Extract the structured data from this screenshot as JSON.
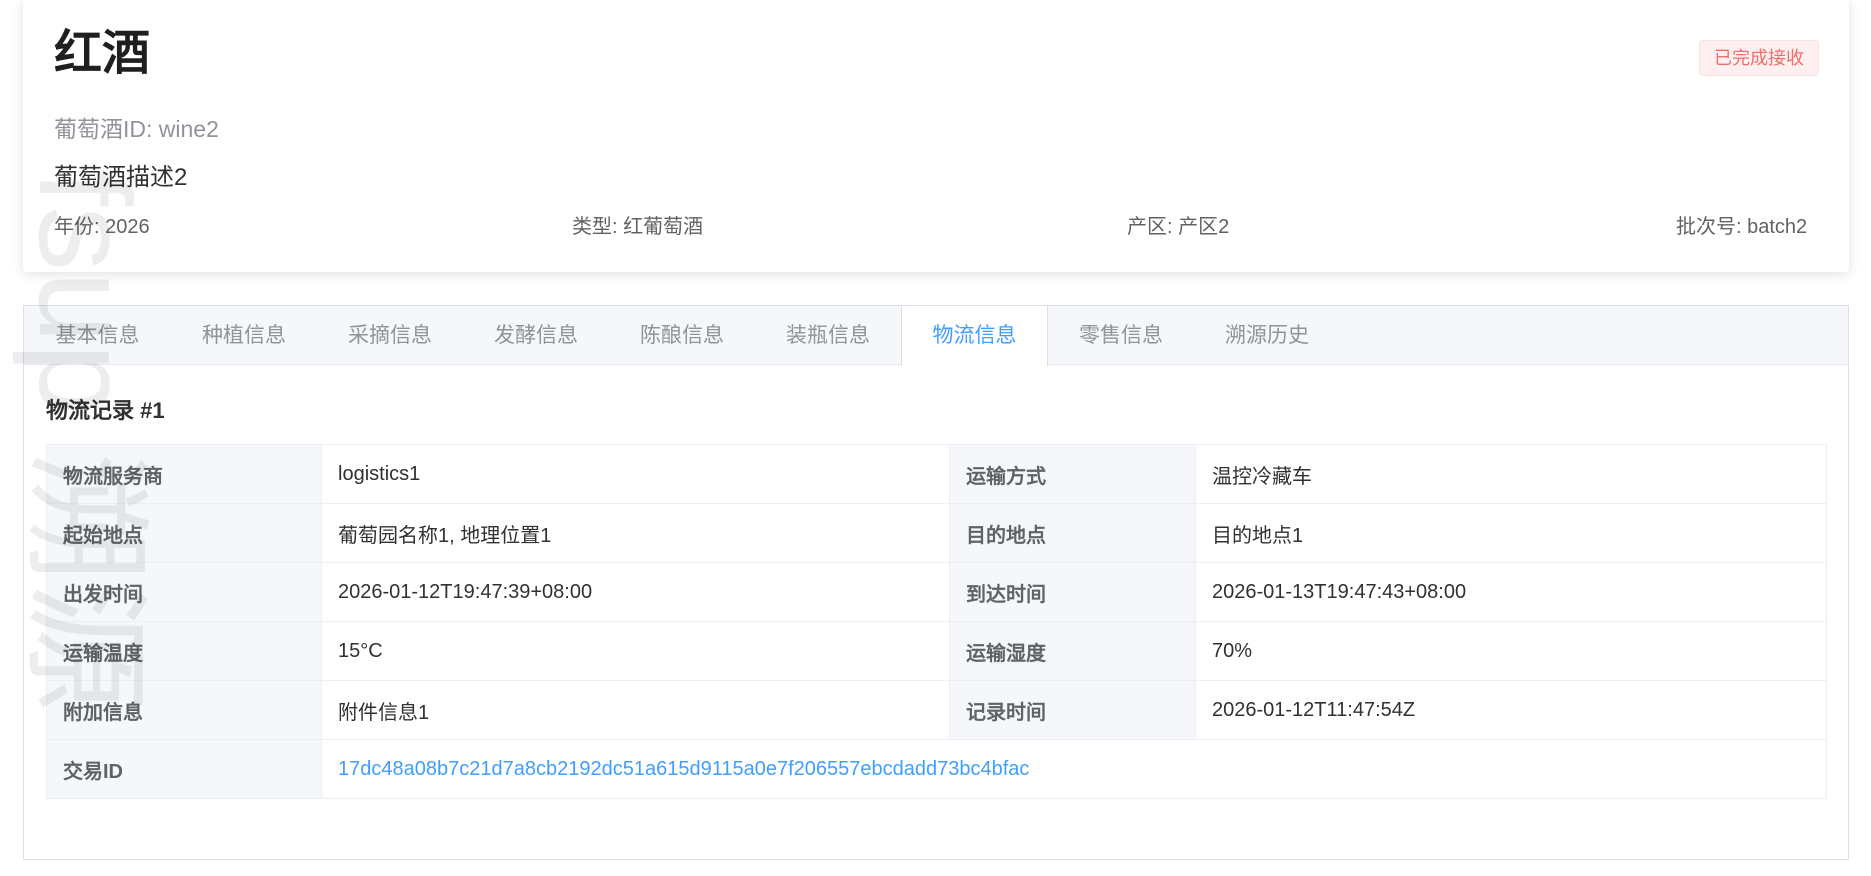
{
  "wine": {
    "name": "红酒",
    "status": "已完成接收",
    "id_text": "葡萄酒ID: wine2",
    "description": "葡萄酒描述2",
    "meta": {
      "year": "年份: 2026",
      "type": "类型: 红葡萄酒",
      "region": "产区: 产区2",
      "batch": "批次号: batch2"
    }
  },
  "tabs": [
    {
      "label": "基本信息"
    },
    {
      "label": "种植信息"
    },
    {
      "label": "采摘信息"
    },
    {
      "label": "发酵信息"
    },
    {
      "label": "陈酿信息"
    },
    {
      "label": "装瓶信息"
    },
    {
      "label": "物流信息",
      "active": true
    },
    {
      "label": "零售信息"
    },
    {
      "label": "溯源历史"
    }
  ],
  "logistics": {
    "section_title": "物流记录 #1",
    "rows": [
      {
        "l1": "物流服务商",
        "v1": "logistics1",
        "l2": "运输方式",
        "v2": "温控冷藏车"
      },
      {
        "l1": "起始地点",
        "v1": "葡萄园名称1, 地理位置1",
        "l2": "目的地点",
        "v2": "目的地点1"
      },
      {
        "l1": "出发时间",
        "v1": "2026-01-12T19:47:39+08:00",
        "l2": "到达时间",
        "v2": "2026-01-13T19:47:43+08:00"
      },
      {
        "l1": "运输温度",
        "v1": "15°C",
        "l2": "运输湿度",
        "v2": "70%"
      },
      {
        "l1": "附加信息",
        "v1": "附件信息1",
        "l2": "记录时间",
        "v2": "2026-01-12T11:47:54Z"
      }
    ],
    "tx_label": "交易ID",
    "tx_value": "17dc48a08b7c21d7a8cb2192dc51a615d9115a0e7f206557ebcdadd73bc4bfac"
  },
  "watermark_text": "fsup 溯源",
  "colors": {
    "accent": "#409eff",
    "status_text": "#f56c6c",
    "status_bg": "#fef0f0",
    "label_bg": "#f5f7fa"
  }
}
